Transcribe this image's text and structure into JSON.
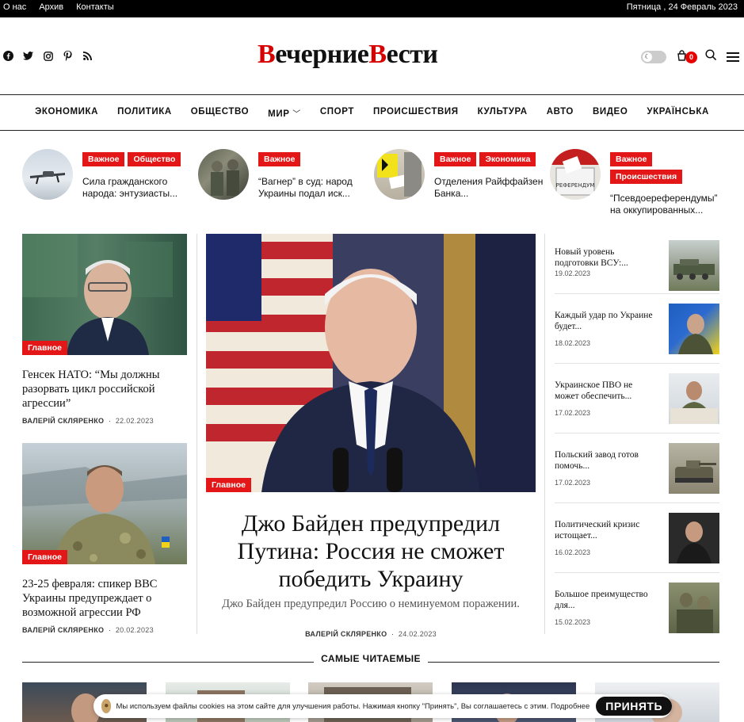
{
  "topbar": {
    "links": [
      "О нас",
      "Архив",
      "Контакты"
    ],
    "date": "Пятница , 24 Февраль 2023"
  },
  "header": {
    "logo_part1_cap": "В",
    "logo_part1": "ечерние",
    "logo_part2_cap": "В",
    "logo_part2": "ести",
    "cart_count": "0",
    "social_icons": [
      "facebook-icon",
      "twitter-icon",
      "instagram-icon",
      "pinterest-icon",
      "rss-icon"
    ]
  },
  "nav": {
    "items": [
      "ЭКОНОМИКА",
      "ПОЛИТИКА",
      "ОБЩЕСТВО",
      "МИР",
      "СПОРТ",
      "ПРОИСШЕСТВИЯ",
      "КУЛЬТУРА",
      "АВТО",
      "ВИДЕО",
      "УКРАЇНСЬКА"
    ]
  },
  "trending": [
    {
      "tags": [
        "Важное",
        "Общество"
      ],
      "title": "Сила гражданского народа: энтузиасты..."
    },
    {
      "tags": [
        "Важное"
      ],
      "title": "“Вагнер” в суд: народ Украины подал иск..."
    },
    {
      "tags": [
        "Важное",
        "Экономика"
      ],
      "title": "Отделения Райффайзен Банка..."
    },
    {
      "tags": [
        "Важное",
        "Происшествия"
      ],
      "title": "“Псевдоереферендумы” на оккупированных..."
    }
  ],
  "left_cards": [
    {
      "tag": "Главное",
      "title": "Генсек НАТО: “Мы должны разорвать цикл российской агрессии”",
      "author": "ВАЛЕРІЙ СКЛЯРЕНКО",
      "date": "22.02.2023"
    },
    {
      "tag": "Главное",
      "title": "23-25 февраля: спикер ВВС Украины предупреждает о возможной агрессии РФ",
      "author": "ВАЛЕРІЙ СКЛЯРЕНКО",
      "date": "20.02.2023"
    }
  ],
  "main": {
    "tag": "Главное",
    "title": "Джо Байден предупредил Путина: Россия не сможет победить Украину",
    "subtitle": "Джо Байден предупредил Россию о неминуемом поражении.",
    "author": "ВАЛЕРІЙ СКЛЯРЕНКО",
    "date": "24.02.2023"
  },
  "right_items": [
    {
      "title": "Новый уровень подготовки ВСУ:...",
      "date": "19.02.2023"
    },
    {
      "title": "Каждый удар по Украине будет...",
      "date": "18.02.2023"
    },
    {
      "title": "Украинское ПВО не может обеспечить...",
      "date": "17.02.2023"
    },
    {
      "title": "Польский завод готов помочь...",
      "date": "17.02.2023"
    },
    {
      "title": "Политический кризис истощает...",
      "date": "16.02.2023"
    },
    {
      "title": "Большое преимущество для...",
      "date": "15.02.2023"
    }
  ],
  "most_read": {
    "label": "САМЫЕ ЧИТАЕМЫЕ"
  },
  "cookie": {
    "text": "Мы используем файлы cookies на этом сайте для улучшения работы. Нажимая кнопку \"Принять\", Вы соглашаетесь с этим. Подробнее",
    "button": "ПРИНЯТЬ"
  }
}
